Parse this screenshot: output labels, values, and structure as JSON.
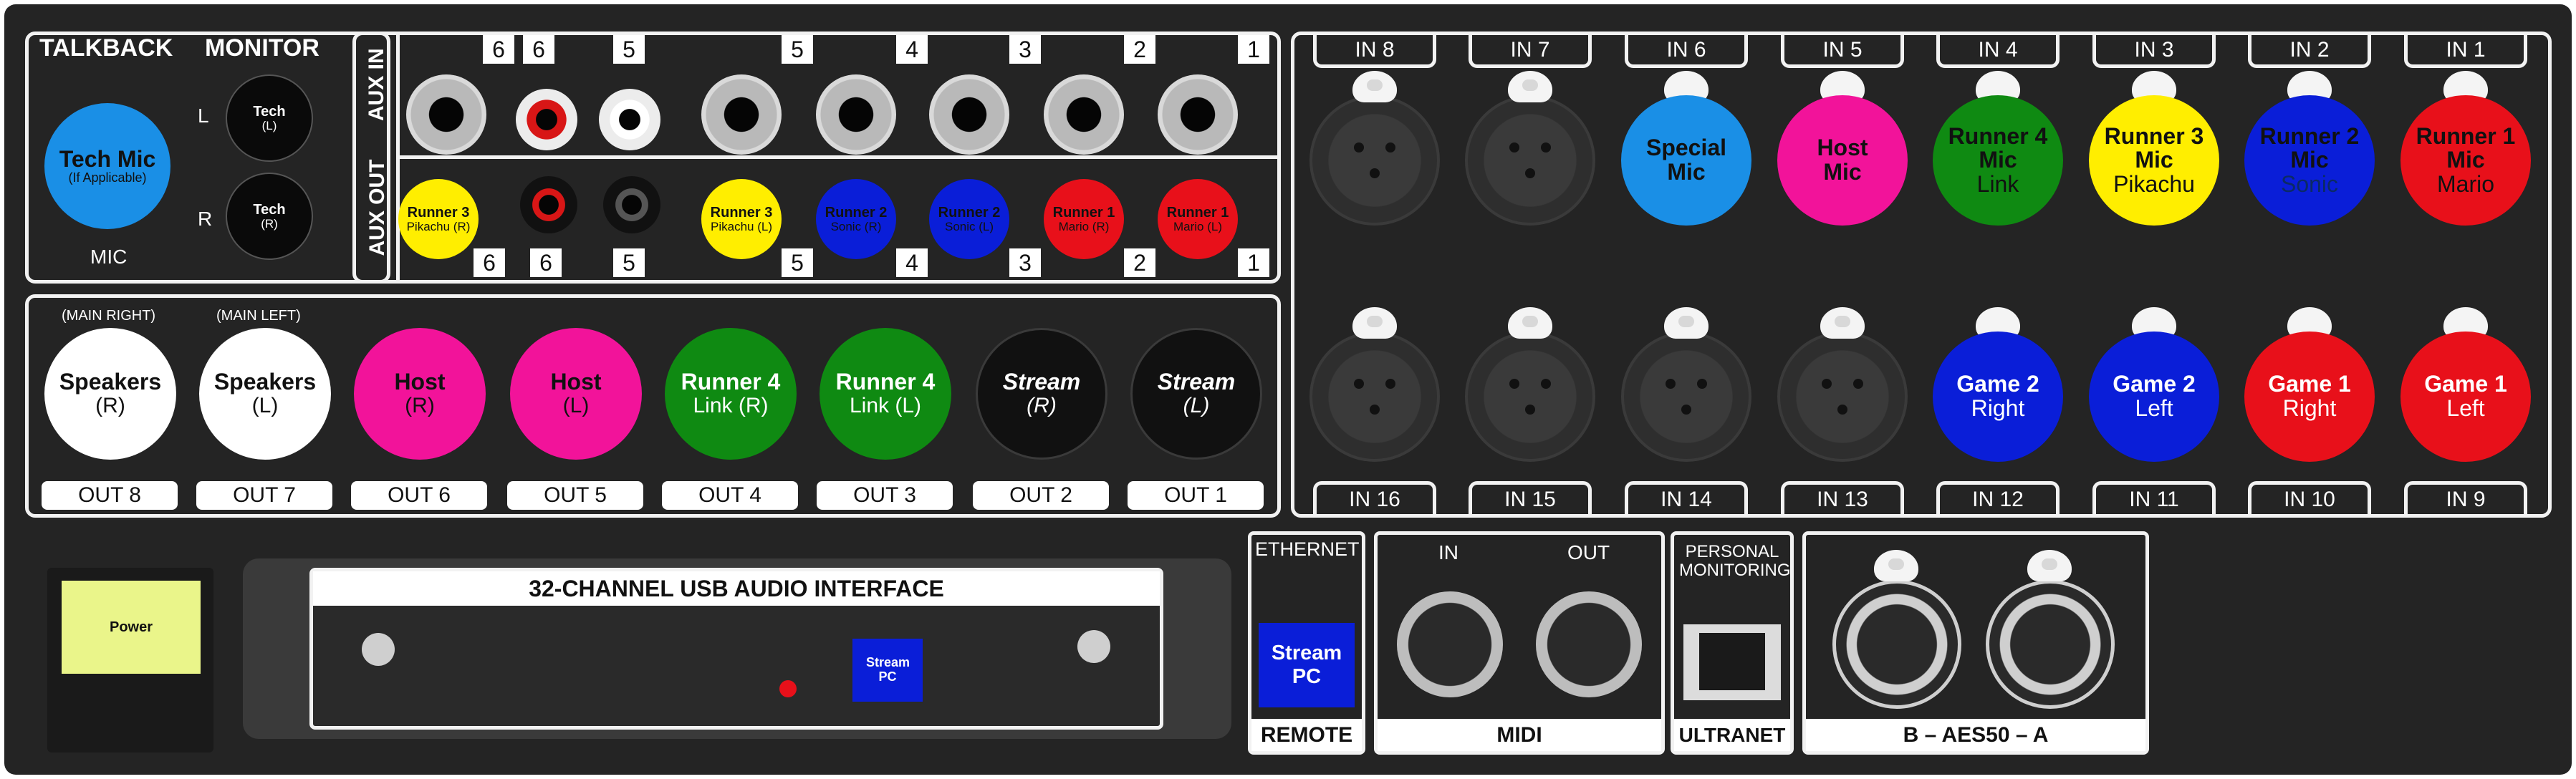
{
  "talkback": {
    "talkback_label": "TALKBACK",
    "monitor_label": "MONITOR",
    "mic": {
      "name": "Tech Mic",
      "sub": "(If Applicable)",
      "color": "#1a8fe6"
    },
    "mic_label": "MIC",
    "monitor_left": {
      "side": "L",
      "name": "Tech",
      "sub": "(L)"
    },
    "monitor_right": {
      "side": "R",
      "name": "Tech",
      "sub": "(R)"
    }
  },
  "aux": {
    "in_label": "AUX IN",
    "out_label": "AUX OUT",
    "in_numbers": [
      "6",
      "6",
      "5",
      "5",
      "4",
      "3",
      "2",
      "1"
    ],
    "out_numbers": [
      "6",
      "6",
      "5",
      "5",
      "4",
      "3",
      "2",
      "1"
    ],
    "outs": [
      {
        "name": "Runner 3",
        "sub": "Pikachu (R)",
        "color": "#ffee00",
        "text_color": "#111111"
      },
      {
        "name": "Runner 3",
        "sub": "Pikachu (L)",
        "color": "#ffee00",
        "text_color": "#111111"
      },
      {
        "name": "Runner 2",
        "sub": "Sonic (R)",
        "color": "#0a1ed8",
        "text_color": "#111111"
      },
      {
        "name": "Runner 2",
        "sub": "Sonic (L)",
        "color": "#0a1ed8",
        "text_color": "#111111"
      },
      {
        "name": "Runner 1",
        "sub": "Mario (R)",
        "color": "#e8101a",
        "text_color": "#111111"
      },
      {
        "name": "Runner 1",
        "sub": "Mario (L)",
        "color": "#e8101a",
        "text_color": "#111111"
      }
    ]
  },
  "outputs": {
    "main_right_label": "(MAIN RIGHT)",
    "main_left_label": "(MAIN LEFT)",
    "items": [
      {
        "name": "Speakers",
        "sub": "(R)",
        "out": "OUT 8",
        "color": "#ffffff",
        "text_color": "#111111"
      },
      {
        "name": "Speakers",
        "sub": "(L)",
        "out": "OUT 7",
        "color": "#ffffff",
        "text_color": "#111111"
      },
      {
        "name": "Host",
        "sub": "(R)",
        "out": "OUT 6",
        "color": "#f2139a",
        "text_color": "#111111"
      },
      {
        "name": "Host",
        "sub": "(L)",
        "out": "OUT 5",
        "color": "#f2139a",
        "text_color": "#111111"
      },
      {
        "name": "Runner 4",
        "sub": "Link (R)",
        "out": "OUT 4",
        "color": "#0f8a12",
        "text_color": "#ffffff"
      },
      {
        "name": "Runner 4",
        "sub": "Link (L)",
        "out": "OUT 3",
        "color": "#0f8a12",
        "text_color": "#ffffff"
      },
      {
        "name": "Stream",
        "sub": "(R)",
        "out": "OUT 2",
        "color": "#111111",
        "text_color": "#ffffff"
      },
      {
        "name": "Stream",
        "sub": "(L)",
        "out": "OUT 1",
        "color": "#111111",
        "text_color": "#ffffff"
      }
    ]
  },
  "inputs": {
    "top": [
      {
        "label": "IN 8",
        "name": "",
        "sub": "",
        "color": ""
      },
      {
        "label": "IN 7",
        "name": "",
        "sub": "",
        "color": ""
      },
      {
        "label": "IN 6",
        "name": "Special",
        "sub": "Mic",
        "color": "#1a8fe6",
        "text_color": "#111111",
        "sub_bold": true
      },
      {
        "label": "IN 5",
        "name": "Host",
        "sub": "Mic",
        "color": "#f2139a",
        "text_color": "#111111",
        "sub_bold": true
      },
      {
        "label": "IN 4",
        "name": "Runner 4 Mic",
        "sub": "Link",
        "color": "#0f8a12",
        "text_color": "#111111"
      },
      {
        "label": "IN 3",
        "name": "Runner 3 Mic",
        "sub": "Pikachu",
        "color": "#ffee00",
        "text_color": "#111111"
      },
      {
        "label": "IN 2",
        "name": "Runner 2 Mic",
        "sub": "Sonic",
        "color": "#0a1ed8",
        "text_color": "#111111"
      },
      {
        "label": "IN 1",
        "name": "Runner 1 Mic",
        "sub": "Mario",
        "color": "#e8101a",
        "text_color": "#111111"
      }
    ],
    "bottom": [
      {
        "label": "IN 16",
        "name": "",
        "sub": "",
        "color": ""
      },
      {
        "label": "IN 15",
        "name": "",
        "sub": "",
        "color": ""
      },
      {
        "label": "IN 14",
        "name": "",
        "sub": "",
        "color": ""
      },
      {
        "label": "IN 13",
        "name": "",
        "sub": "",
        "color": ""
      },
      {
        "label": "IN 12",
        "name": "Game 2",
        "sub": "Right",
        "color": "#0a1ed8",
        "text_color": "#ffffff"
      },
      {
        "label": "IN 11",
        "name": "Game 2",
        "sub": "Left",
        "color": "#0a1ed8",
        "text_color": "#ffffff"
      },
      {
        "label": "IN 10",
        "name": "Game 1",
        "sub": "Right",
        "color": "#e8101a",
        "text_color": "#ffffff"
      },
      {
        "label": "IN 9",
        "name": "Game 1",
        "sub": "Left",
        "color": "#e8101a",
        "text_color": "#ffffff"
      }
    ]
  },
  "power": {
    "label": "Power",
    "color": "#eaf58a"
  },
  "usb": {
    "title": "32-CHANNEL USB AUDIO INTERFACE",
    "port_label": "Stream PC",
    "port_color": "#0a1ed8",
    "led_color": "#e8101a"
  },
  "remote": {
    "top_label": "ETHERNET",
    "port_label": "Stream PC",
    "bottom_label": "REMOTE",
    "port_color": "#0a1ed8"
  },
  "midi": {
    "in_label": "IN",
    "out_label": "OUT",
    "bottom_label": "MIDI"
  },
  "ultranet": {
    "top_label": "PERSONAL MONITORING",
    "bottom_label": "ULTRANET"
  },
  "aes50": {
    "bottom_label": "B – AES50 – A"
  }
}
